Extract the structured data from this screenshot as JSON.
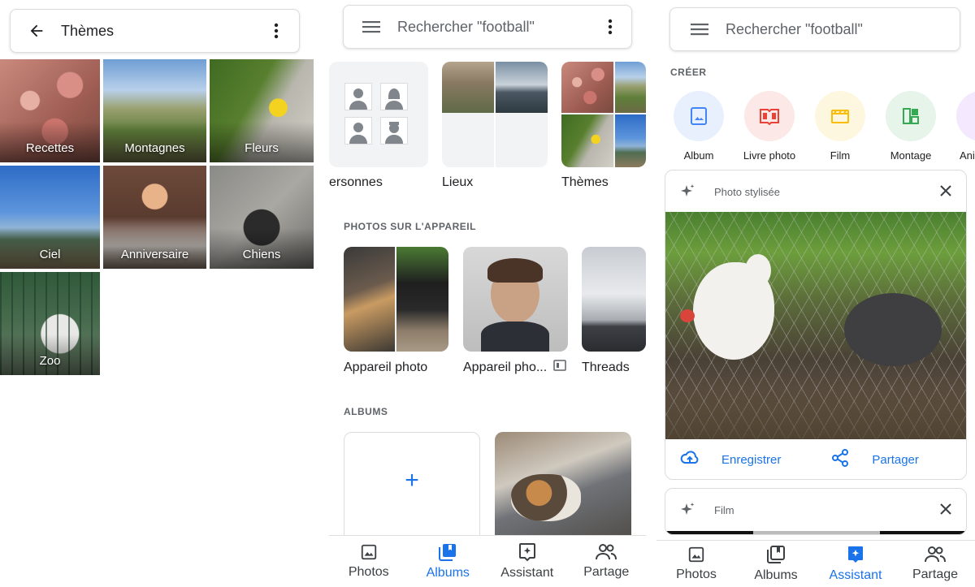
{
  "panel_themes": {
    "title": "Thèmes",
    "tiles": [
      {
        "label": "Recettes"
      },
      {
        "label": "Montagnes"
      },
      {
        "label": "Fleurs"
      },
      {
        "label": "Ciel"
      },
      {
        "label": "Anniversaire"
      },
      {
        "label": "Chiens"
      },
      {
        "label": "Zoo"
      }
    ]
  },
  "panel_albums": {
    "search_placeholder": "Rechercher \"football\"",
    "categories": [
      {
        "label": "ersonnes"
      },
      {
        "label": "Lieux"
      },
      {
        "label": "Thèmes"
      }
    ],
    "device_section": "PHOTOS SUR L'APPAREIL",
    "device_folders": [
      {
        "label": "Appareil photo"
      },
      {
        "label": "Appareil pho..."
      },
      {
        "label": "Threads"
      }
    ],
    "albums_section": "ALBUMS",
    "new_album_glyph": "+"
  },
  "panel_assistant": {
    "search_placeholder": "Rechercher \"football\"",
    "create_section": "CRÉER",
    "create_items": [
      {
        "label": "Album",
        "color": "#4285f4"
      },
      {
        "label": "Livre photo",
        "color": "#ea4335"
      },
      {
        "label": "Film",
        "color": "#fbbc04"
      },
      {
        "label": "Montage",
        "color": "#34a853"
      },
      {
        "label": "Anim",
        "color": "#a142f4"
      }
    ],
    "card1": {
      "title": "Photo stylisée",
      "save": "Enregistrer",
      "share": "Partager"
    },
    "card2": {
      "title": "Film"
    }
  },
  "nav": {
    "photos": "Photos",
    "albums": "Albums",
    "assistant": "Assistant",
    "sharing": "Partage"
  },
  "colors": {
    "accent": "#1a73e8",
    "text": "#202124",
    "muted": "#5f6368"
  }
}
